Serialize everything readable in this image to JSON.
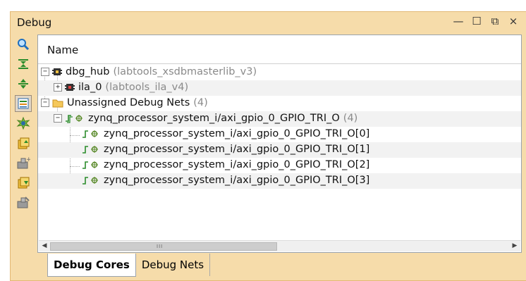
{
  "panel": {
    "title": "Debug",
    "controls": {
      "minimize": "—",
      "maximize": "☐",
      "restore": "⧉",
      "close": "×"
    }
  },
  "toolbar": [
    "search-icon",
    "collapse-all-icon",
    "expand-all-icon",
    "grouping-icon",
    "auto-detect-icon",
    "assign-icon",
    "add-probe-icon",
    "remove-icon",
    "delete-icon"
  ],
  "table": {
    "column_header": "Name",
    "rows": [
      {
        "name": "dbg_hub",
        "suffix": "(labtools_xsdbmasterlib_v3)"
      },
      {
        "name": "ila_0",
        "suffix": "(labtools_ila_v4)"
      },
      {
        "name": "Unassigned Debug Nets",
        "suffix": "(4)"
      },
      {
        "name": "zynq_processor_system_i/axi_gpio_0_GPIO_TRI_O",
        "suffix": "(4)"
      },
      {
        "name": "zynq_processor_system_i/axi_gpio_0_GPIO_TRI_O[0]",
        "suffix": ""
      },
      {
        "name": "zynq_processor_system_i/axi_gpio_0_GPIO_TRI_O[1]",
        "suffix": ""
      },
      {
        "name": "zynq_processor_system_i/axi_gpio_0_GPIO_TRI_O[2]",
        "suffix": ""
      },
      {
        "name": "zynq_processor_system_i/axi_gpio_0_GPIO_TRI_O[3]",
        "suffix": ""
      }
    ]
  },
  "scrollbar": {
    "left_arrow": "◀",
    "right_arrow": "▶",
    "grip": "III"
  },
  "tabs": [
    {
      "label": "Debug Cores"
    },
    {
      "label": "Debug Nets"
    }
  ],
  "colors": {
    "panel_bg": "#f6dcaa",
    "accent": "#e3b875"
  }
}
